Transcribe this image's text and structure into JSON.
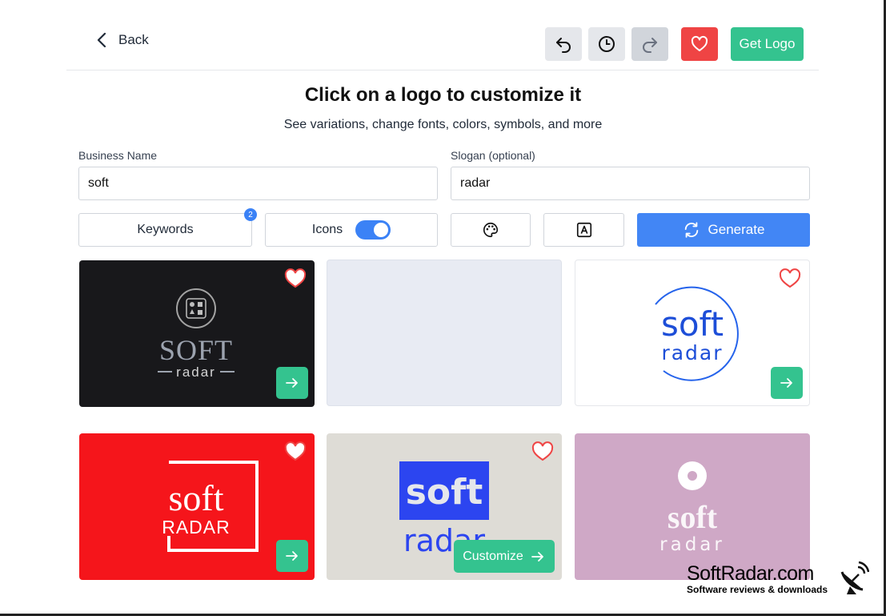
{
  "nav": {
    "back_label": "Back",
    "get_logo_label": "Get Logo"
  },
  "header": {
    "title": "Click on a logo to customize it",
    "subtitle": "See variations, change fonts, colors, symbols, and more"
  },
  "form": {
    "business_name_label": "Business Name",
    "business_name_value": "soft",
    "slogan_label": "Slogan (optional)",
    "slogan_value": "radar"
  },
  "options": {
    "keywords_label": "Keywords",
    "keywords_count": "2",
    "icons_label": "Icons",
    "icons_enabled": true,
    "generate_label": "Generate"
  },
  "logos": {
    "card1": {
      "name": "SOFT",
      "slogan": "radar"
    },
    "card3": {
      "name": "soft",
      "slogan": "radar"
    },
    "card4": {
      "name": "soft",
      "slogan": "RADAR"
    },
    "card5": {
      "name": "soft",
      "slogan": "radar",
      "customize_label": "Customize"
    },
    "card6": {
      "name": "soft",
      "slogan": "radar"
    }
  },
  "colors": {
    "accent_green": "#34c38f",
    "accent_blue": "#4286f5",
    "favorite_red": "#ef4444"
  },
  "watermark": {
    "title": "SoftRadar.com",
    "subtitle": "Software reviews & downloads"
  }
}
